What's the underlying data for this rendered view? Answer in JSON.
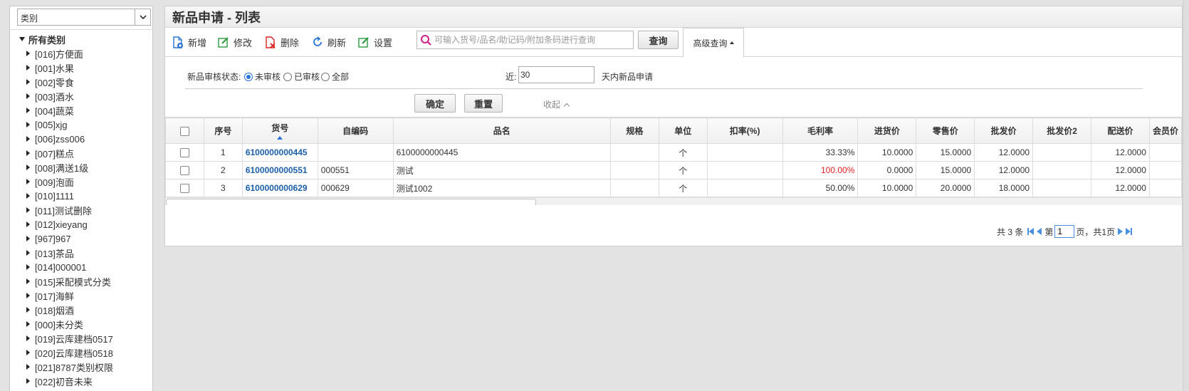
{
  "sidebar": {
    "select_value": "类别",
    "root_label": "所有类别",
    "items": [
      "[016]方便面",
      "[001]水果",
      "[002]零食",
      "[003]酒水",
      "[004]蔬菜",
      "[005]xjg",
      "[006]zss006",
      "[007]糕点",
      "[008]满送1级",
      "[009]泡面",
      "[010]1111",
      "[011]测试删除",
      "[012]xieyang",
      "[967]967",
      "[013]茶品",
      "[014]000001",
      "[015]采配模式分类",
      "[017]海鲜",
      "[018]烟酒",
      "[000]未分类",
      "[019]云库建档0517",
      "[020]云库建档0518",
      "[021]8787类别权限",
      "[022]初音未来"
    ]
  },
  "page": {
    "title": "新品申请 - 列表"
  },
  "toolbar": {
    "add": "新增",
    "edit": "修改",
    "delete": "删除",
    "refresh": "刷新",
    "settings": "设置",
    "search_placeholder": "可输入货号/品名/助记码/附加条码进行查询",
    "query": "查询",
    "advanced": "高级查询"
  },
  "filter": {
    "status_label": "新品审核状态:",
    "opt_unreviewed": "未审核",
    "opt_reviewed": "已审核",
    "opt_all": "全部",
    "near_label": "近:",
    "near_value": "30",
    "near_suffix": "天内新品申请",
    "confirm": "确定",
    "reset": "重置",
    "collapse": "收起"
  },
  "table": {
    "headers": [
      "序号",
      "货号",
      "自编码",
      "品名",
      "规格",
      "单位",
      "扣率(%)",
      "毛利率",
      "进货价",
      "零售价",
      "批发价",
      "批发价2",
      "配送价",
      "会员价"
    ],
    "rows": [
      {
        "no": "1",
        "code": "6100000000445",
        "selfcode": "",
        "name": "6100000000445",
        "spec": "",
        "unit": "个",
        "discount": "",
        "margin": "33.33%",
        "purchase": "10.0000",
        "retail": "15.0000",
        "wholesale": "12.0000",
        "wholesale2": "",
        "delivery": "12.0000"
      },
      {
        "no": "2",
        "code": "6100000000551",
        "selfcode": "000551",
        "name": "测试",
        "spec": "",
        "unit": "个",
        "discount": "",
        "margin": "100.00%",
        "purchase": "0.0000",
        "retail": "15.0000",
        "wholesale": "12.0000",
        "wholesale2": "",
        "delivery": "12.0000"
      },
      {
        "no": "3",
        "code": "6100000000629",
        "selfcode": "000629",
        "name": "测试1002",
        "spec": "",
        "unit": "个",
        "discount": "",
        "margin": "50.00%",
        "purchase": "10.0000",
        "retail": "20.0000",
        "wholesale": "18.0000",
        "wholesale2": "",
        "delivery": "12.0000"
      }
    ]
  },
  "pager": {
    "total": "共 3 条",
    "page_prefix": "第",
    "page_value": "1",
    "page_suffix": "页，共1页"
  },
  "colors": {
    "accent": "#2a74d8",
    "link": "#1c5fa8",
    "alert": "#e02020"
  }
}
